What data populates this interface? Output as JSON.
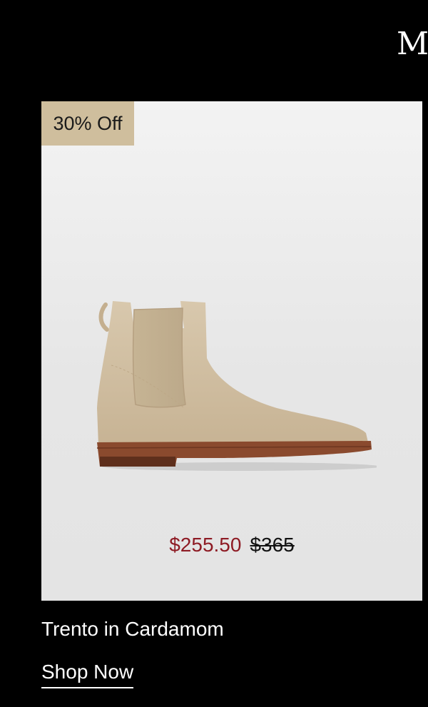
{
  "header": {
    "initial": "M"
  },
  "product": {
    "badge": "30% Off",
    "name": "Trento in Cardamom",
    "price_sale": "$255.50",
    "price_original": "$365",
    "image_alt": "Chelsea boot in cardamom suede",
    "cta_label": "Shop Now"
  },
  "colors": {
    "page_background": "#000000",
    "badge_background": "#cfbe9d",
    "sale_price": "#8e1b24",
    "card_background": "#ececec"
  }
}
